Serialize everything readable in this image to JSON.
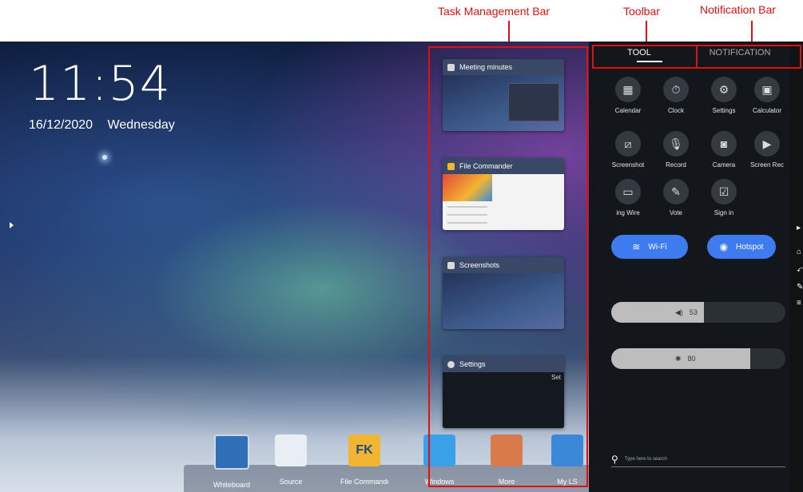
{
  "annotations": {
    "task_bar": "Task Management Bar",
    "toolbar": "Toolbar",
    "notification_bar": "Notification Bar"
  },
  "lock": {
    "time": "11:54",
    "date": "16/12/2020",
    "weekday": "Wednesday"
  },
  "tasks": [
    {
      "title": "Meeting minutes"
    },
    {
      "title": "File Commander"
    },
    {
      "title": "Screenshots"
    },
    {
      "title": "Settings",
      "body_text": "Set"
    }
  ],
  "dock": [
    {
      "label": "Whiteboard",
      "icon": "whiteboard-icon",
      "color": "#2f6fb8"
    },
    {
      "label": "Source",
      "icon": "source-icon",
      "color": "#e9eef5"
    },
    {
      "label": "File Commander",
      "icon": "file-commander-icon",
      "color": "#f2b531"
    },
    {
      "label": "Windows",
      "icon": "windows-icon",
      "color": "#3aa0e8"
    },
    {
      "label": "More",
      "icon": "app-box-icon",
      "color": "#d97a4a"
    },
    {
      "label": "My LS",
      "icon": "usb-icon",
      "color": "#3c88d8"
    }
  ],
  "panel": {
    "tabs": [
      "TOOL",
      "NOTIFICATION"
    ],
    "tools": [
      {
        "label": "Calendar",
        "glyph": "▦"
      },
      {
        "label": "Clock",
        "glyph": "⏱"
      },
      {
        "label": "Settings",
        "glyph": "⚙"
      },
      {
        "label": "Calculator",
        "glyph": "▣"
      },
      {
        "label": "Screenshot",
        "glyph": "⧄"
      },
      {
        "label": "Record",
        "glyph": "🎙"
      },
      {
        "label": "Camera",
        "glyph": "◙"
      },
      {
        "label": "Screen Rec",
        "glyph": "▶"
      },
      {
        "label": "ing   Wire",
        "glyph": "▭"
      },
      {
        "label": "Vote",
        "glyph": "✎"
      },
      {
        "label": "Sign in",
        "glyph": "☑"
      }
    ],
    "wifi": {
      "label": "Wi-Fi",
      "glyph": "≋"
    },
    "hotspot": {
      "label": "Hotspot",
      "glyph": "◉"
    },
    "volume": {
      "value": "53",
      "level": 0.53,
      "glyph": "◀)"
    },
    "brightness": {
      "value": "80",
      "level": 0.8,
      "glyph": "✺"
    },
    "search_placeholder": "Type here to search"
  },
  "colors": {
    "accent": "#3e7bf0",
    "annotation": "#e01010"
  }
}
